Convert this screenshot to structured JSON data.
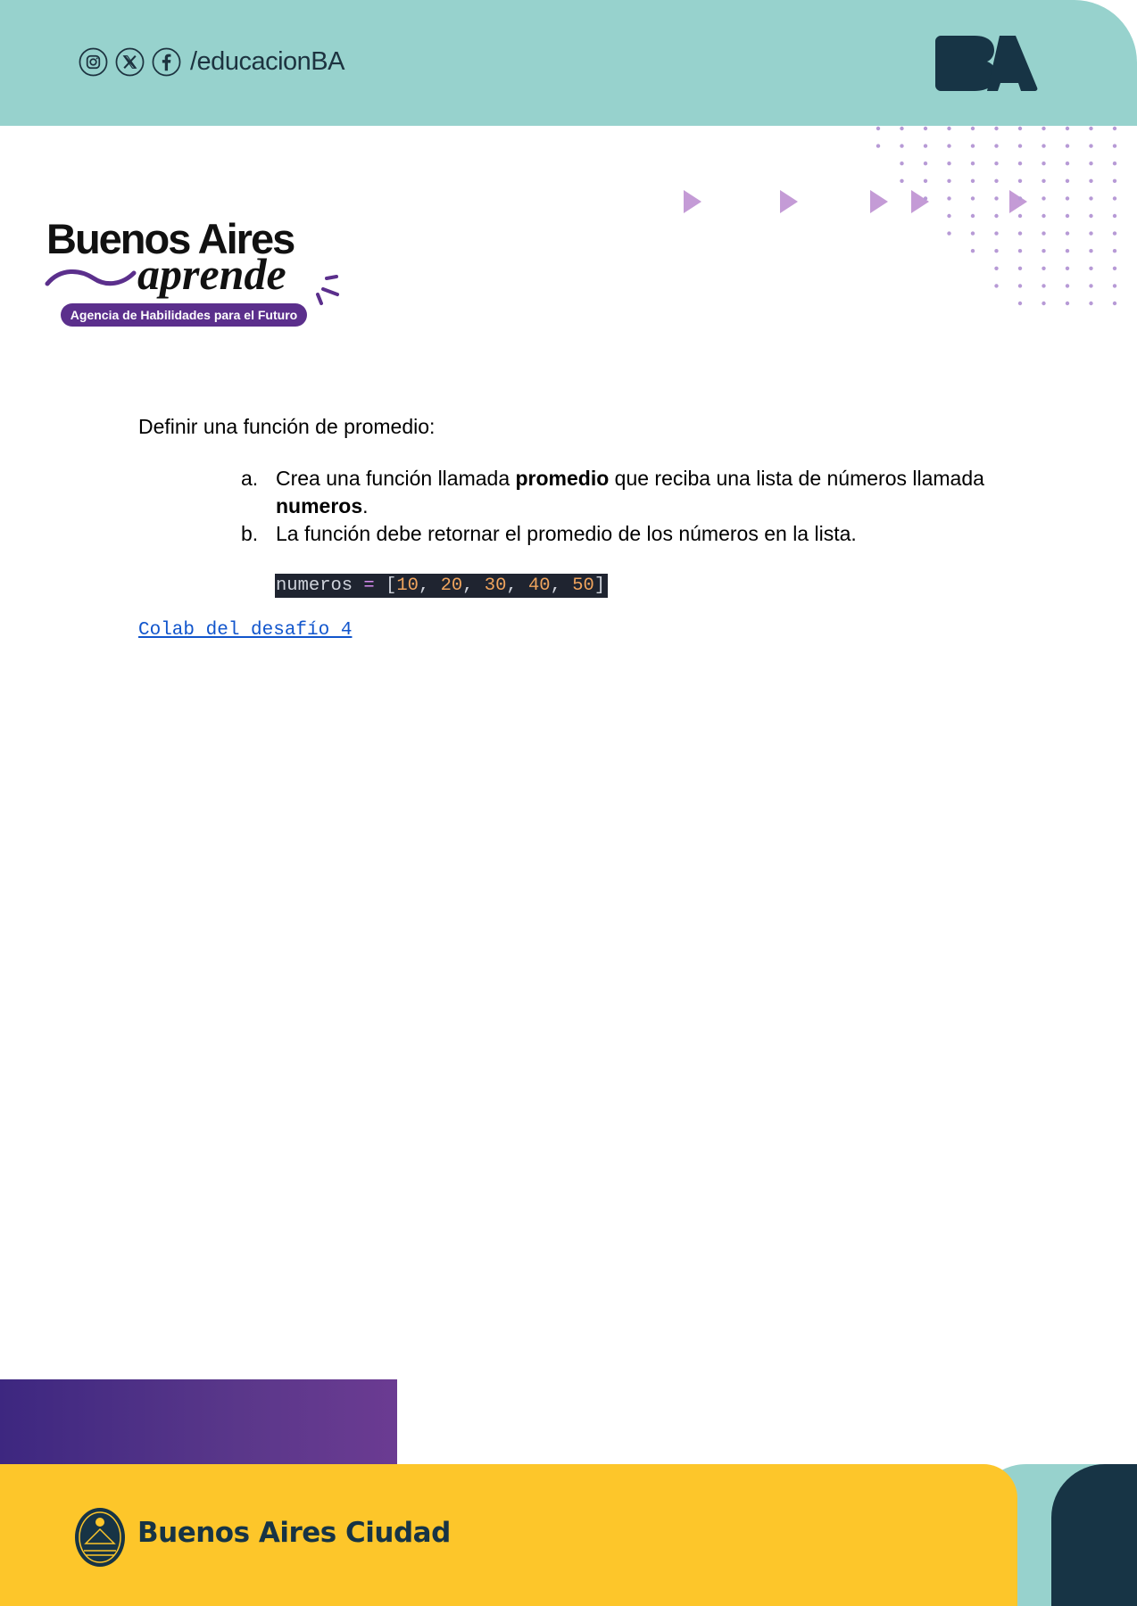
{
  "header": {
    "social_handle": "/educacionBA",
    "icons": [
      "instagram-icon",
      "x-icon",
      "facebook-icon"
    ],
    "brand_mark": "BA",
    "bg_color": "#97d2cd",
    "brand_color": "#173445"
  },
  "logo": {
    "line1": "Buenos Aires",
    "line2": "aprende",
    "tagline": "Agencia de Habilidades para el Futuro"
  },
  "content": {
    "intro": "Definir una función de promedio:",
    "items": [
      {
        "marker": "a.",
        "text_before": "Crea una función llamada ",
        "bold1": "promedio",
        "text_middle": " que reciba una lista de números llamada ",
        "bold2": "numeros",
        "text_after": "."
      },
      {
        "marker": "b.",
        "text": "La función debe retornar el promedio de los números en la lista."
      }
    ],
    "code": {
      "var": "numeros",
      "op": " = ",
      "open": "[",
      "values": [
        "10",
        "20",
        "30",
        "40",
        "50"
      ],
      "close": "]"
    },
    "link": "Colab del desafío 4"
  },
  "footer": {
    "city_name": "Buenos Aires Ciudad",
    "yellow": "#fdc62a",
    "purple": "#5a378a"
  }
}
